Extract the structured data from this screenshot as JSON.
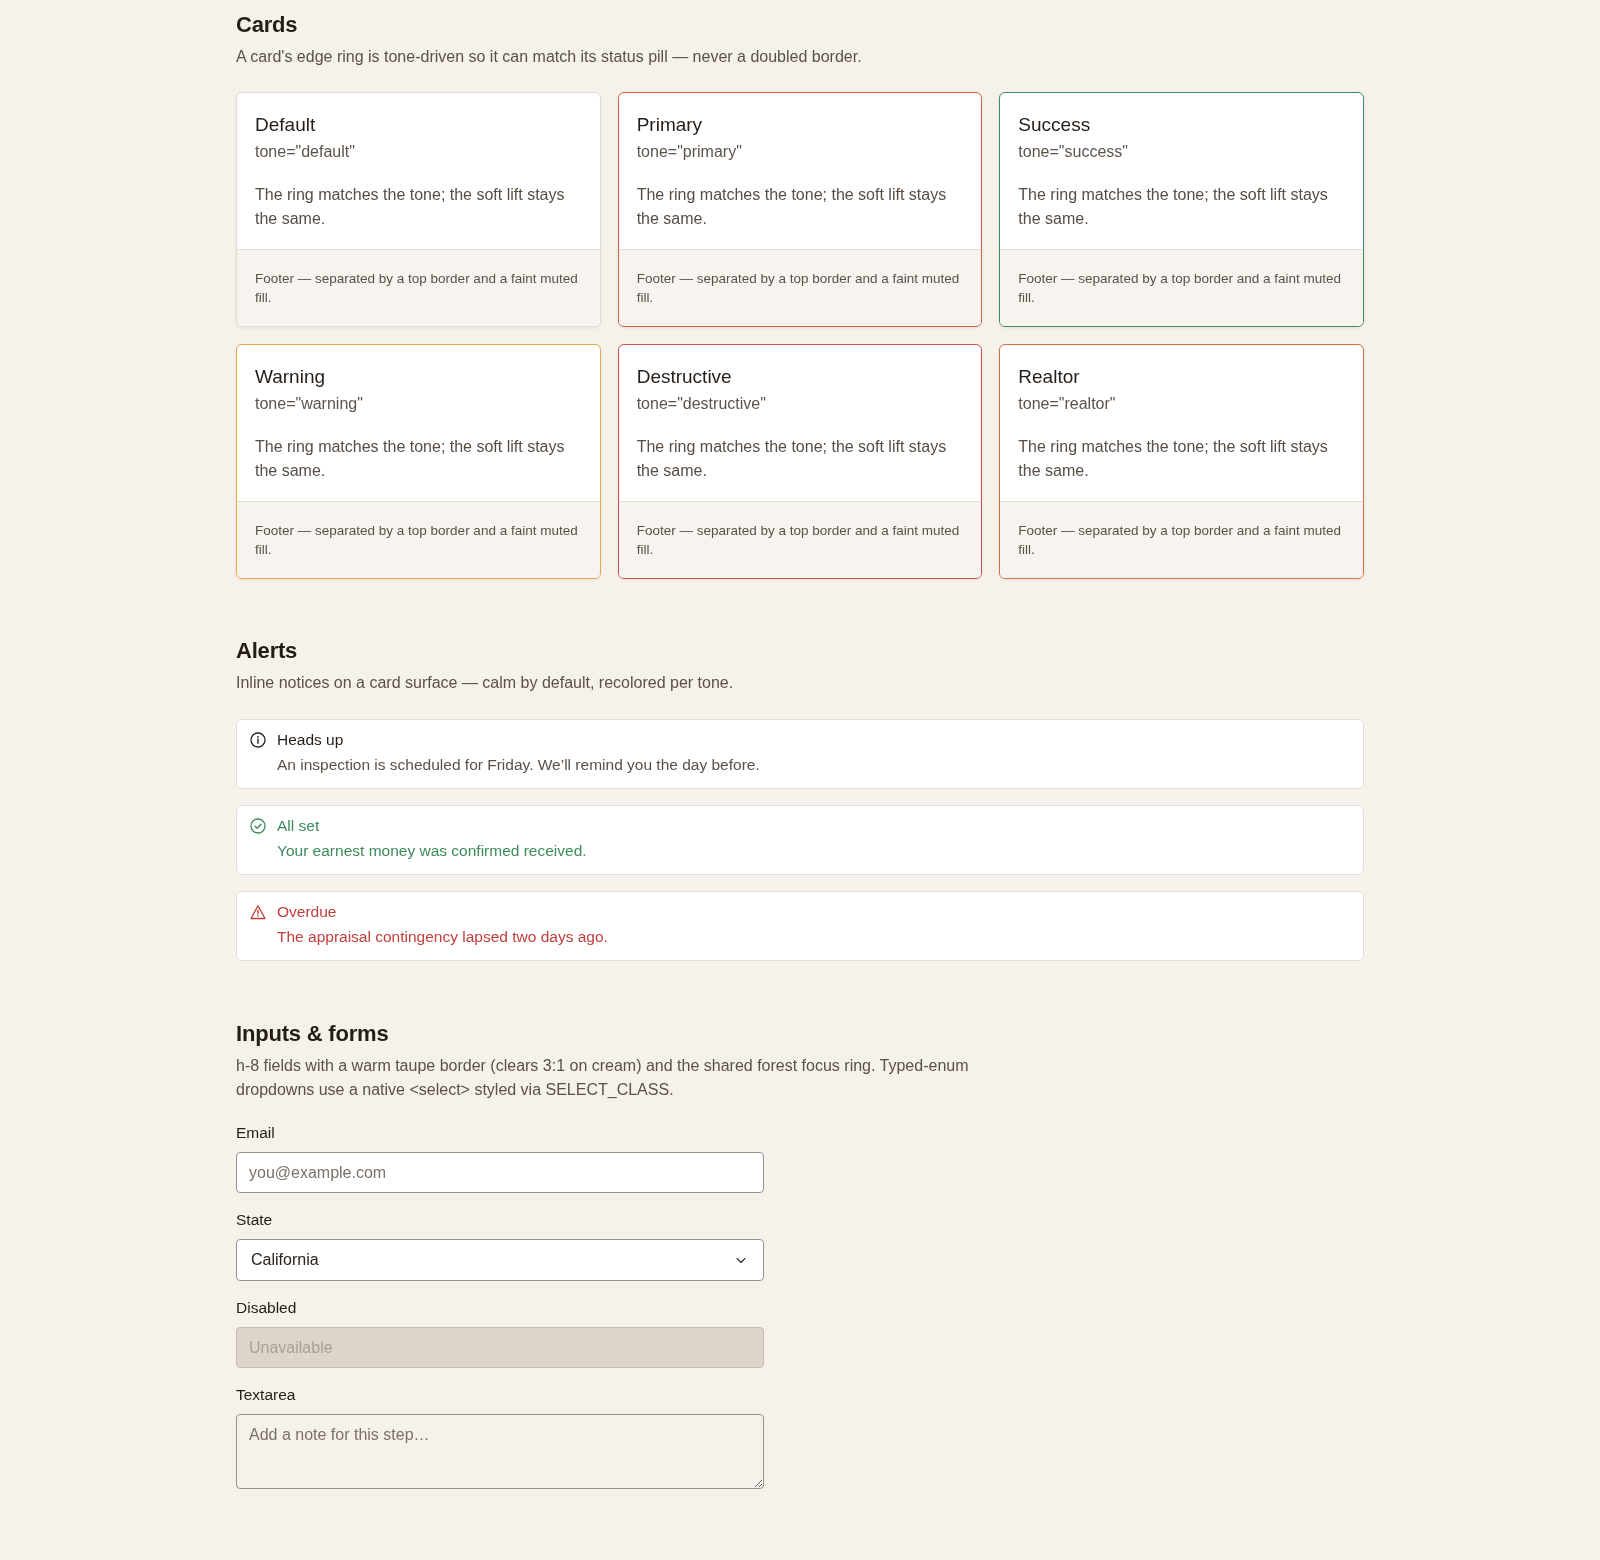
{
  "cards_section": {
    "title": "Cards",
    "description": "A card's edge ring is tone-driven so it can match its status pill — never a doubled border.",
    "cards": [
      {
        "title": "Default",
        "tone_code": "tone=\"default\"",
        "body": "The ring matches the tone; the soft lift stays the same.",
        "footer": "Footer — separated by a top border and a faint muted fill.",
        "color": "#e2dbd2"
      },
      {
        "title": "Primary",
        "tone_code": "tone=\"primary\"",
        "body": "The ring matches the tone; the soft lift stays the same.",
        "footer": "Footer — separated by a top border and a faint muted fill.",
        "color": "#cf6440"
      },
      {
        "title": "Success",
        "tone_code": "tone=\"success\"",
        "body": "The ring matches the tone; the soft lift stays the same.",
        "footer": "Footer — separated by a top border and a faint muted fill.",
        "color": "#3f8a60"
      },
      {
        "title": "Warning",
        "tone_code": "tone=\"warning\"",
        "body": "The ring matches the tone; the soft lift stays the same.",
        "footer": "Footer — separated by a top border and a faint muted fill.",
        "color": "#e4aa48"
      },
      {
        "title": "Destructive",
        "tone_code": "tone=\"destructive\"",
        "body": "The ring matches the tone; the soft lift stays the same.",
        "footer": "Footer — separated by a top border and a faint muted fill.",
        "color": "#c9504d"
      },
      {
        "title": "Realtor",
        "tone_code": "tone=\"realtor\"",
        "body": "The ring matches the tone; the soft lift stays the same.",
        "footer": "Footer — separated by a top border and a faint muted fill.",
        "color": "#d27044"
      }
    ]
  },
  "alerts_section": {
    "title": "Alerts",
    "description": "Inline notices on a card surface — calm by default, recolored per tone.",
    "alerts": [
      {
        "kind": "info",
        "title": "Heads up",
        "message": "An inspection is scheduled for Friday. We’ll remind you the day before."
      },
      {
        "kind": "success",
        "title": "All set",
        "message": "Your earnest money was confirmed received."
      },
      {
        "kind": "error",
        "title": "Overdue",
        "message": "The appraisal contingency lapsed two days ago."
      }
    ]
  },
  "forms_section": {
    "title": "Inputs & forms",
    "description": "h-8 fields with a warm taupe border (clears 3:1 on cream) and the shared forest focus ring. Typed-enum dropdowns use a native <select> styled via SELECT_CLASS.",
    "fields": [
      {
        "kind": "input",
        "label": "Email",
        "placeholder": "you@example.com",
        "disabled": false
      },
      {
        "kind": "select",
        "label": "State",
        "value": "California",
        "disabled": false
      },
      {
        "kind": "input",
        "label": "Disabled",
        "placeholder": "Unavailable",
        "disabled": true
      },
      {
        "kind": "textarea",
        "label": "Textarea",
        "placeholder": "Add a note for this step…",
        "disabled": false
      }
    ]
  }
}
